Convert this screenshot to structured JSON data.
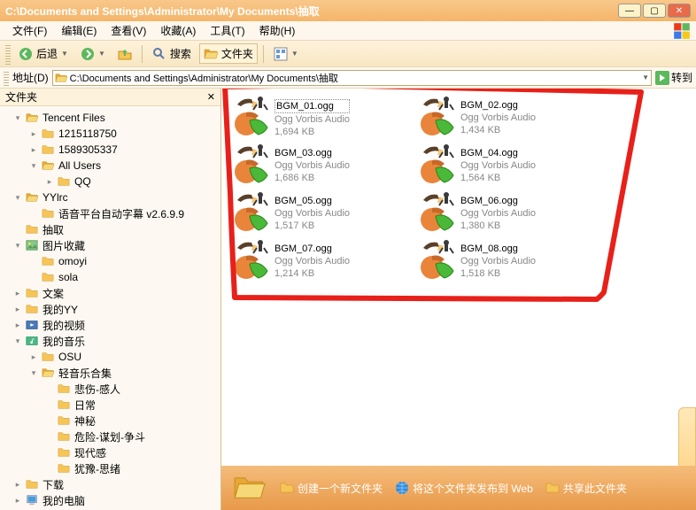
{
  "title": "C:\\Documents and Settings\\Administrator\\My Documents\\抽取",
  "menus": [
    "文件(F)",
    "编辑(E)",
    "查看(V)",
    "收藏(A)",
    "工具(T)",
    "帮助(H)"
  ],
  "toolbar": {
    "back": "后退",
    "search": "搜索",
    "folders": "文件夹"
  },
  "address": {
    "label": "地址(D)",
    "path": "C:\\Documents and Settings\\Administrator\\My Documents\\抽取",
    "go": "转到"
  },
  "sidebar": {
    "header": "文件夹",
    "tree": [
      {
        "indent": 0,
        "tw": "▾",
        "icon": "folder-open",
        "label": "Tencent Files"
      },
      {
        "indent": 1,
        "tw": "▸",
        "icon": "folder",
        "label": "1215118750"
      },
      {
        "indent": 1,
        "tw": "▸",
        "icon": "folder",
        "label": "1589305337"
      },
      {
        "indent": 1,
        "tw": "▾",
        "icon": "folder-open",
        "label": "All Users"
      },
      {
        "indent": 2,
        "tw": "▸",
        "icon": "folder",
        "label": "QQ"
      },
      {
        "indent": 0,
        "tw": "▾",
        "icon": "folder-open",
        "label": "YYlrc"
      },
      {
        "indent": 1,
        "tw": "",
        "icon": "folder",
        "label": "语音平台自动字幕 v2.6.9.9"
      },
      {
        "indent": 0,
        "tw": "",
        "icon": "folder",
        "label": "抽取"
      },
      {
        "indent": 0,
        "tw": "▾",
        "icon": "pic",
        "label": "图片收藏"
      },
      {
        "indent": 1,
        "tw": "",
        "icon": "folder",
        "label": "omoyi"
      },
      {
        "indent": 1,
        "tw": "",
        "icon": "folder",
        "label": "sola"
      },
      {
        "indent": 0,
        "tw": "▸",
        "icon": "folder",
        "label": "文案"
      },
      {
        "indent": 0,
        "tw": "▸",
        "icon": "folder",
        "label": "我的YY"
      },
      {
        "indent": 0,
        "tw": "▸",
        "icon": "video",
        "label": "我的视频"
      },
      {
        "indent": 0,
        "tw": "▾",
        "icon": "music",
        "label": "我的音乐"
      },
      {
        "indent": 1,
        "tw": "▸",
        "icon": "folder",
        "label": "OSU"
      },
      {
        "indent": 1,
        "tw": "▾",
        "icon": "folder-open",
        "label": "轻音乐合集"
      },
      {
        "indent": 2,
        "tw": "",
        "icon": "folder",
        "label": "悲伤-感人"
      },
      {
        "indent": 2,
        "tw": "",
        "icon": "folder",
        "label": "日常"
      },
      {
        "indent": 2,
        "tw": "",
        "icon": "folder",
        "label": "神秘"
      },
      {
        "indent": 2,
        "tw": "",
        "icon": "folder",
        "label": "危险-谋划-争斗"
      },
      {
        "indent": 2,
        "tw": "",
        "icon": "folder",
        "label": "现代感"
      },
      {
        "indent": 2,
        "tw": "",
        "icon": "folder",
        "label": "犹豫-思绪"
      },
      {
        "indent": 0,
        "tw": "▸",
        "icon": "folder",
        "label": "下载"
      },
      {
        "indent": 0,
        "tw": "▸",
        "icon": "computer",
        "label": "我的电脑"
      }
    ]
  },
  "files": [
    {
      "name": "BGM_01.ogg",
      "type": "Ogg Vorbis Audio",
      "size": "1,694 KB",
      "selected": true
    },
    {
      "name": "BGM_02.ogg",
      "type": "Ogg Vorbis Audio",
      "size": "1,434 KB"
    },
    {
      "name": "BGM_03.ogg",
      "type": "Ogg Vorbis Audio",
      "size": "1,686 KB"
    },
    {
      "name": "BGM_04.ogg",
      "type": "Ogg Vorbis Audio",
      "size": "1,564 KB"
    },
    {
      "name": "BGM_05.ogg",
      "type": "Ogg Vorbis Audio",
      "size": "1,517 KB"
    },
    {
      "name": "BGM_06.ogg",
      "type": "Ogg Vorbis Audio",
      "size": "1,380 KB"
    },
    {
      "name": "BGM_07.ogg",
      "type": "Ogg Vorbis Audio",
      "size": "1,214 KB"
    },
    {
      "name": "BGM_08.ogg",
      "type": "Ogg Vorbis Audio",
      "size": "1,518 KB"
    }
  ],
  "taskbar": {
    "newfolder": "创建一个新文件夹",
    "publish": "将这个文件夹发布到 Web",
    "share": "共享此文件夹"
  }
}
